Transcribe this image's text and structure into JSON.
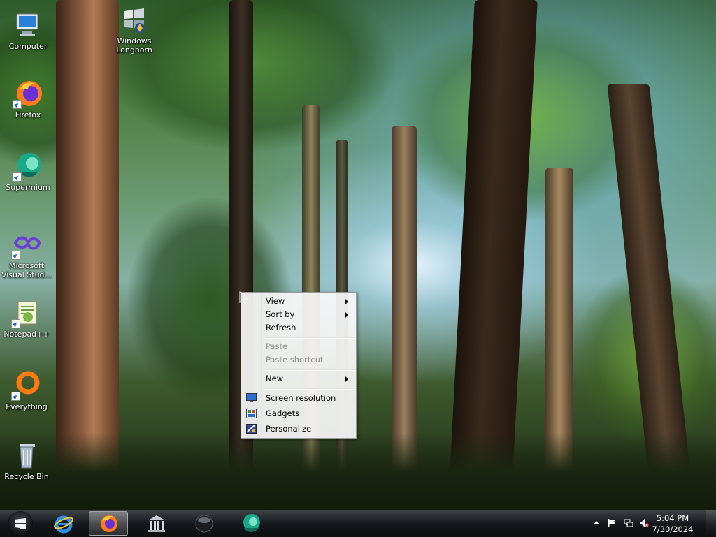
{
  "desktop_icons": [
    {
      "label": "Computer",
      "icon": "computer-icon"
    },
    {
      "label": "Windows Longhorn",
      "icon": "windows-longhorn-icon"
    },
    {
      "label": "Firefox",
      "icon": "firefox-icon"
    },
    {
      "label": "Supermium",
      "icon": "supermium-icon"
    },
    {
      "label": "Microsoft Visual Stud...",
      "icon": "visual-studio-icon"
    },
    {
      "label": "Notepad++",
      "icon": "notepad-plus-plus-icon"
    },
    {
      "label": "Everything",
      "icon": "everything-icon"
    },
    {
      "label": "Recycle Bin",
      "icon": "recycle-bin-icon"
    }
  ],
  "context_menu": {
    "items": [
      {
        "label": "View",
        "submenu": true,
        "enabled": true
      },
      {
        "label": "Sort by",
        "submenu": true,
        "enabled": true
      },
      {
        "label": "Refresh",
        "submenu": false,
        "enabled": true
      },
      {
        "label": "Paste",
        "submenu": false,
        "enabled": false
      },
      {
        "label": "Paste shortcut",
        "submenu": false,
        "enabled": false
      },
      {
        "label": "New",
        "submenu": true,
        "enabled": true
      },
      {
        "label": "Screen resolution",
        "submenu": false,
        "enabled": true,
        "icon": "screen-resolution-icon"
      },
      {
        "label": "Gadgets",
        "submenu": false,
        "enabled": true,
        "icon": "gadgets-icon"
      },
      {
        "label": "Personalize",
        "submenu": false,
        "enabled": true,
        "icon": "personalize-icon"
      }
    ]
  },
  "taskbar": {
    "pinned": [
      {
        "name": "internet-explorer",
        "icon": "internet-explorer-icon",
        "active": false
      },
      {
        "name": "firefox",
        "icon": "firefox-icon",
        "active": true
      },
      {
        "name": "library",
        "icon": "library-icon",
        "active": false
      },
      {
        "name": "media",
        "icon": "media-orb-icon",
        "active": false
      },
      {
        "name": "supermium",
        "icon": "supermium-icon",
        "active": false
      }
    ],
    "tray_icons": [
      "show-hidden-icons-icon",
      "action-center-flag-icon",
      "network-icon",
      "volume-muted-icon"
    ],
    "clock": {
      "time": "5:04 PM",
      "date": "7/30/2024"
    }
  },
  "colors": {
    "taskbar": "#15181c",
    "menu_background": "#f8f8f8",
    "menu_disabled_text": "#8d8d8d"
  }
}
